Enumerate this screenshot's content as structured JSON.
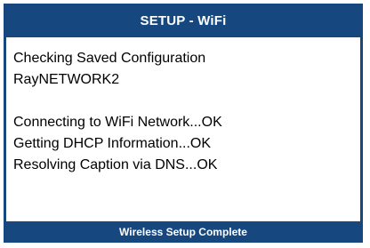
{
  "header": {
    "title": "SETUP - WiFi"
  },
  "content": {
    "lines": [
      "Checking Saved Configuration",
      "RayNETWORK2",
      "",
      "Connecting to WiFi Network...OK",
      "Getting DHCP Information...OK",
      "Resolving Caption via DNS...OK"
    ]
  },
  "footer": {
    "status": "Wireless Setup Complete"
  },
  "colors": {
    "frame": "#16487f",
    "background": "#ffffff",
    "text": "#000000",
    "header_text": "#ffffff"
  }
}
